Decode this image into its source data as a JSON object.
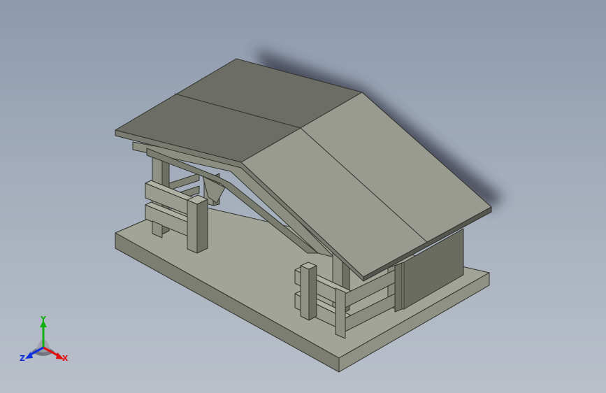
{
  "viewport": {
    "background_top": "#8d9aae",
    "background_bottom": "#b9c0ca"
  },
  "model": {
    "colors": {
      "face_light": "#a0a294",
      "face_mid": "#8a8c7e",
      "face_dark": "#6e7064",
      "face_darker": "#5e6055",
      "roof_front": "#9a9b90",
      "roof_back": "#6c6d64",
      "shadow": "#3c4150"
    }
  },
  "triad": {
    "x_label": "X",
    "y_label": "Y",
    "z_label": "Z",
    "x_color": "#e01010",
    "y_color": "#10b010",
    "z_color": "#1030e0"
  }
}
